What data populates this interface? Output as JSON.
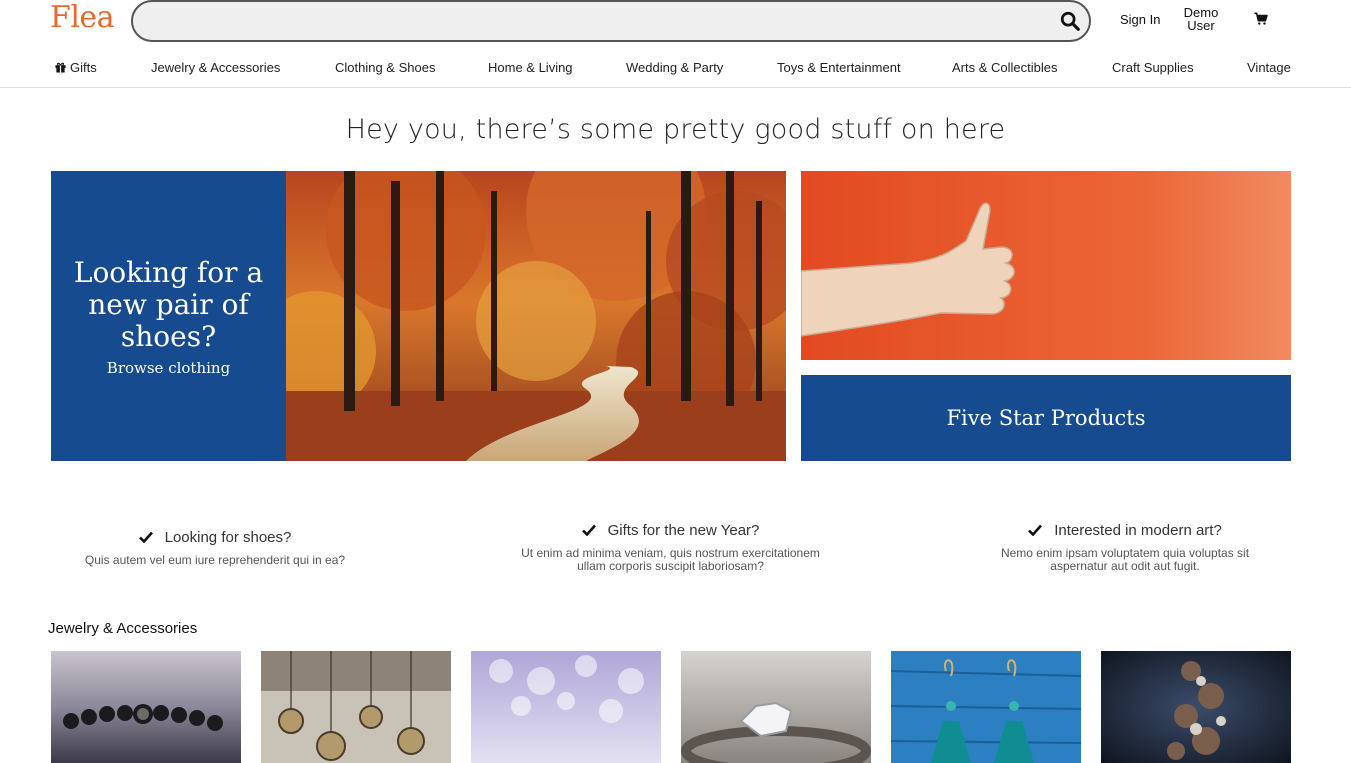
{
  "header": {
    "logo": "Flea",
    "search_placeholder": "",
    "sign_in": "Sign In",
    "user_line1": "Demo",
    "user_line2": "User"
  },
  "nav": {
    "items": [
      {
        "label": "Gifts",
        "icon": "gift-icon"
      },
      {
        "label": "Jewelry & Accessories"
      },
      {
        "label": "Clothing & Shoes"
      },
      {
        "label": "Home & Living"
      },
      {
        "label": "Wedding & Party"
      },
      {
        "label": "Toys & Entertainment"
      },
      {
        "label": "Arts & Collectibles"
      },
      {
        "label": "Craft Supplies"
      },
      {
        "label": "Vintage"
      }
    ]
  },
  "hero": {
    "headline": "Hey you, there’s some pretty good stuff on here",
    "promo_title": "Looking for a new pair of shoes?",
    "promo_link": "Browse clothing",
    "five_star": "Five Star Products"
  },
  "features": [
    {
      "title": "Looking for shoes?",
      "desc": "Quis autem vel eum iure reprehenderit qui in ea?"
    },
    {
      "title": "Gifts for the new Year?",
      "desc": "Ut enim ad minima veniam, quis nostrum exercitationem ullam corporis suscipit laboriosam?"
    },
    {
      "title": "Interested in modern art?",
      "desc": "Nemo enim ipsam voluptatem quia voluptas sit aspernatur aut odit aut fugit."
    }
  ],
  "section": {
    "title": "Jewelry & Accessories"
  },
  "colors": {
    "brand_orange": "#e8692a",
    "promo_blue": "#174b8f"
  }
}
